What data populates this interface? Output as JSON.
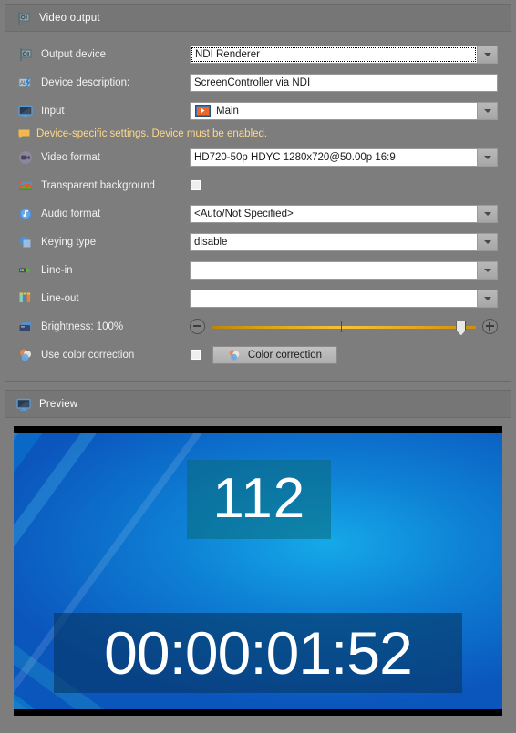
{
  "video_output": {
    "header": {
      "title": "Video output",
      "icon": "video-output-icon"
    },
    "rows": [
      {
        "key": "output_device",
        "label": "Output device",
        "icon": "video-output-icon",
        "type": "combo",
        "value": "NDI Renderer",
        "focused": true
      },
      {
        "key": "device_description",
        "label": "Device description:",
        "icon": "alt-text-icon",
        "type": "textbox",
        "value": "ScreenController via NDI"
      },
      {
        "key": "input",
        "label": "Input",
        "icon": "monitor-icon",
        "type": "combo",
        "value": "Main",
        "item_icon": "media-thumbnail-icon"
      },
      {
        "key": "video_format",
        "label": "Video format",
        "icon": "camera-icon",
        "type": "combo",
        "value": "HD720-50p HDYC 1280x720@50.00p 16:9"
      },
      {
        "key": "transparent_background",
        "label": "Transparent background",
        "icon": "image-icon",
        "type": "checkbox",
        "checked": false
      },
      {
        "key": "audio_format",
        "label": "Audio format",
        "icon": "music-note-icon",
        "type": "combo",
        "value": "<Auto/Not Specified>"
      },
      {
        "key": "keying_type",
        "label": "Keying type",
        "icon": "keying-icon",
        "type": "combo",
        "value": "disable"
      },
      {
        "key": "line_in",
        "label": "Line-in",
        "icon": "line-in-icon",
        "type": "combo",
        "value": ""
      },
      {
        "key": "line_out",
        "label": "Line-out",
        "icon": "line-out-icon",
        "type": "combo",
        "value": ""
      },
      {
        "key": "brightness",
        "label": "Brightness: 100%",
        "icon": "brightness-icon",
        "type": "slider",
        "value": 100,
        "min": 0,
        "max": 108
      },
      {
        "key": "use_color_correction",
        "label": "Use color correction",
        "icon": "color-correction-icon",
        "type": "checkbox_button",
        "checked": false,
        "button_label": "Color correction"
      }
    ],
    "note": {
      "icon": "note-balloon-icon",
      "text": "Device-specific settings. Device must be enabled."
    }
  },
  "preview": {
    "header": {
      "title": "Preview",
      "icon": "monitor-icon"
    },
    "video": {
      "counter": "112",
      "timecode": "00:00:01:52"
    }
  },
  "colors": {
    "window_bg": "#7d7d7d",
    "panel_header_bg": "#767676",
    "panel_border": "#6a6a6a",
    "field_bg": "#ffffff",
    "field_text": "#1a1a1a",
    "label_text": "#f2f2f2",
    "note_text": "#ffd98a",
    "slider_track": "#e3a61d",
    "preview_blue": "#0e7fd4"
  }
}
